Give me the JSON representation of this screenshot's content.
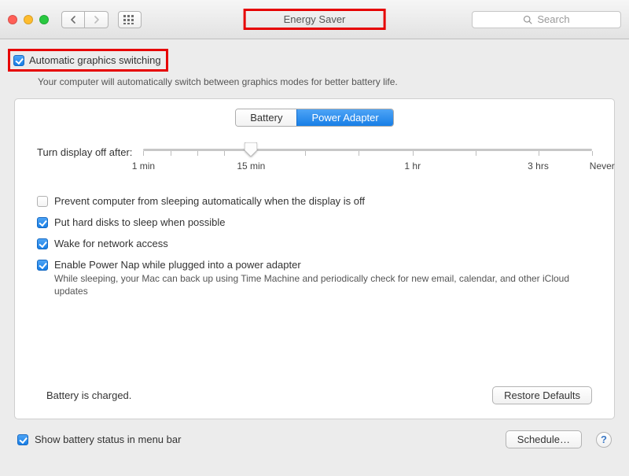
{
  "window": {
    "title": "Energy Saver"
  },
  "search": {
    "placeholder": "Search"
  },
  "auto_graphics": {
    "label": "Automatic graphics switching",
    "subtext": "Your computer will automatically switch between graphics modes for better battery life.",
    "checked": true
  },
  "tabs": {
    "battery": "Battery",
    "power_adapter": "Power Adapter",
    "active": "power_adapter"
  },
  "slider": {
    "label": "Turn display off after:",
    "ticks": [
      "1 min",
      "15 min",
      "1 hr",
      "3 hrs",
      "Never"
    ],
    "value_position_pct": 24
  },
  "options": [
    {
      "label": "Prevent computer from sleeping automatically when the display is off",
      "checked": false
    },
    {
      "label": "Put hard disks to sleep when possible",
      "checked": true
    },
    {
      "label": "Wake for network access",
      "checked": true
    },
    {
      "label": "Enable Power Nap while plugged into a power adapter",
      "checked": true,
      "sub": "While sleeping, your Mac can back up using Time Machine and periodically check for new email, calendar, and other iCloud updates"
    }
  ],
  "status": "Battery is charged.",
  "buttons": {
    "restore_defaults": "Restore Defaults",
    "schedule": "Schedule…"
  },
  "menu_bar": {
    "label": "Show battery status in menu bar",
    "checked": true
  },
  "help": "?"
}
